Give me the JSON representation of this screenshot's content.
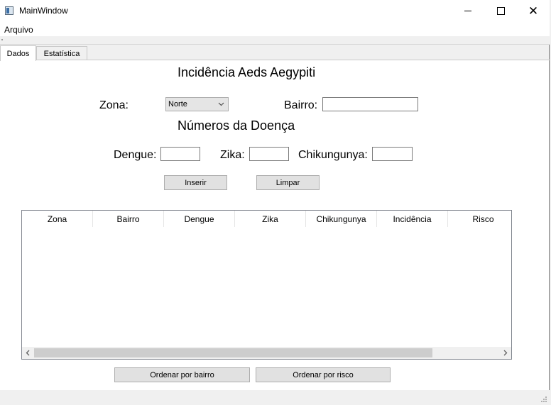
{
  "window": {
    "title": "MainWindow",
    "minimize": "—",
    "maximize": "☐",
    "close": "✕"
  },
  "menubar": {
    "items": [
      {
        "label": "Arquivo"
      }
    ]
  },
  "tabs": [
    {
      "label": "Dados",
      "active": true
    },
    {
      "label": "Estatística",
      "active": false
    }
  ],
  "form": {
    "title": "Incidência Aeds Aegypiti",
    "zona_label": "Zona:",
    "zona_value": "Norte",
    "bairro_label": "Bairro:",
    "bairro_value": "",
    "section_title": "Números da Doença",
    "dengue_label": "Dengue:",
    "dengue_value": "",
    "zika_label": "Zika:",
    "zika_value": "",
    "chikungunya_label": "Chikungunya:",
    "chikungunya_value": "",
    "insert_button": "Inserir",
    "clear_button": "Limpar"
  },
  "table": {
    "columns": [
      "Zona",
      "Bairro",
      "Dengue",
      "Zika",
      "Chikungunya",
      "Incidência",
      "Risco"
    ],
    "rows": []
  },
  "buttons": {
    "sort_bairro": "Ordenar por bairro",
    "sort_risco": "Ordenar por risco"
  },
  "icons": {
    "app": "app-window-icon",
    "combo": "chevron-down-icon",
    "scroll_left": "chevron-left-icon",
    "scroll_right": "chevron-right-icon"
  },
  "colors": {
    "button_face": "#e1e1e1",
    "border": "#7a7a7a",
    "scroll_thumb": "#cdcdcd"
  }
}
